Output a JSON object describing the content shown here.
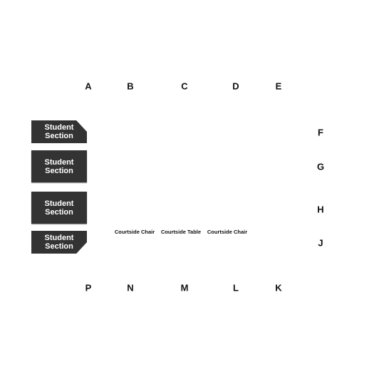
{
  "top_labels": [
    "A",
    "B",
    "C",
    "D",
    "E"
  ],
  "right_labels": [
    "F",
    "G",
    "H",
    "J"
  ],
  "bottom_labels": [
    "P",
    "N",
    "M",
    "L",
    "K"
  ],
  "sections": [
    "Student Section",
    "Student Section",
    "Student Section",
    "Student Section"
  ],
  "courtside": [
    "Courtside Chair",
    "Courtside Table",
    "Courtside Chair"
  ],
  "colors": {
    "section_fill": "#333333",
    "section_text": "#ffffff",
    "label_text": "#111111"
  }
}
